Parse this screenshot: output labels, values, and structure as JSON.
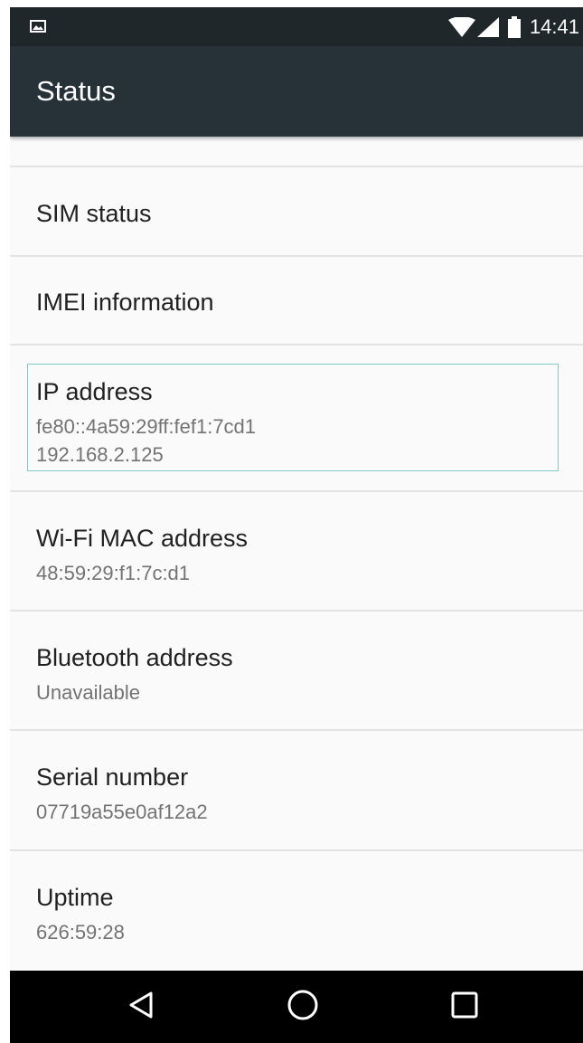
{
  "status_bar": {
    "time": "14:41",
    "notification_icon": "image-icon",
    "wifi_icon": "wifi-icon",
    "signal_icon": "cell-signal-icon",
    "battery_icon": "battery-icon"
  },
  "toolbar": {
    "title": "Status"
  },
  "items": {
    "sim": {
      "title": "SIM status"
    },
    "imei": {
      "title": "IMEI information"
    },
    "ip": {
      "title": "IP address",
      "sub1": "fe80::4a59:29ff:fef1:7cd1",
      "sub2": "192.168.2.125"
    },
    "wifi_mac": {
      "title": "Wi-Fi MAC address",
      "sub": "48:59:29:f1:7c:d1"
    },
    "bluetooth": {
      "title": "Bluetooth address",
      "sub": "Unavailable"
    },
    "serial": {
      "title": "Serial number",
      "sub": "07719a55e0af12a2"
    },
    "uptime": {
      "title": "Uptime",
      "sub": "626:59:28"
    }
  },
  "nav_bar": {
    "back_icon": "back-triangle-icon",
    "home_icon": "home-circle-icon",
    "recents_icon": "recents-square-icon"
  },
  "colors": {
    "status_bar": "#1f272a",
    "toolbar": "#263238",
    "background": "#fafafa",
    "focus_outline": "#80cbc4"
  }
}
